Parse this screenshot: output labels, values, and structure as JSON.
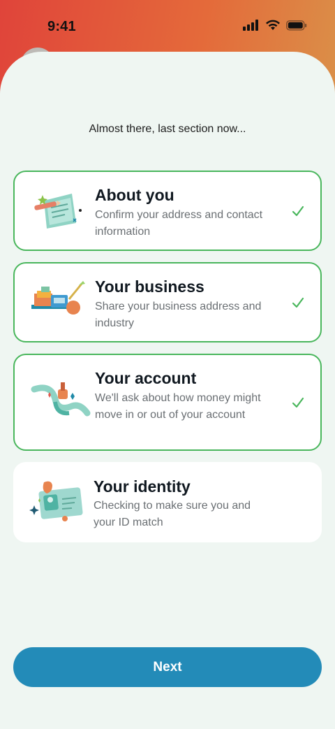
{
  "status_bar": {
    "time": "9:41"
  },
  "subtitle": "Almost there, last section now...",
  "sections": [
    {
      "title": "About you",
      "description": "Confirm your address and contact information",
      "completed": true,
      "icon": "document-pencil-icon"
    },
    {
      "title": "Your business",
      "description": "Share your business address and industry",
      "completed": true,
      "icon": "business-desk-icon"
    },
    {
      "title": "Your account",
      "description": "We'll ask about how money might move in or out of your account",
      "completed": true,
      "icon": "ribbon-cup-icon"
    },
    {
      "title": "Your identity",
      "description": "Checking to make sure you and your ID match",
      "completed": false,
      "icon": "id-card-icon"
    }
  ],
  "next_button": "Next",
  "colors": {
    "accent": "#238bb8",
    "check": "#49b65c",
    "sheet": "#eff6f2"
  }
}
